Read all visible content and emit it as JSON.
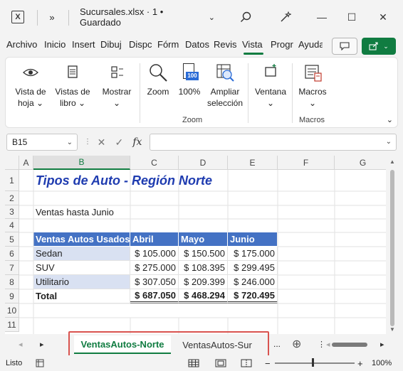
{
  "titlebar": {
    "app_letter": "X",
    "qat_more": "»",
    "doc_title": "Sucursales.xlsx  ·  1 • Guardado",
    "title_caret": "⌄",
    "minimize": "—",
    "maximize": "☐",
    "close": "✕"
  },
  "tabs": [
    {
      "label": "Archivo"
    },
    {
      "label": "Inicio"
    },
    {
      "label": "Insert"
    },
    {
      "label": "Dibuj"
    },
    {
      "label": "Dispc"
    },
    {
      "label": "Fórm"
    },
    {
      "label": "Datos"
    },
    {
      "label": "Revis"
    },
    {
      "label": "Vista"
    },
    {
      "label": "Progr"
    },
    {
      "label": "Ayuda"
    }
  ],
  "ribbon": {
    "vista_hoja": "Vista de\nhoja ⌄",
    "vistas_libro": "Vistas de\nlibro ⌄",
    "mostrar": "Mostrar\n⌄",
    "zoom": "Zoom",
    "zoom100": "100%",
    "zoom100_icon": "100",
    "ampliar": "Ampliar\nselección",
    "ventana": "Ventana\n⌄",
    "macros": "Macros\n⌄",
    "group_zoom": "Zoom",
    "group_macros": "Macros"
  },
  "formula_bar": {
    "name_box": "B15",
    "cancel": "✕",
    "confirm": "✓",
    "fx": "fx",
    "value": ""
  },
  "columns": [
    "A",
    "B",
    "C",
    "D",
    "E",
    "F",
    "G"
  ],
  "rows": [
    "1",
    "2",
    "3",
    "4",
    "5",
    "6",
    "7",
    "8",
    "9",
    "10",
    "11"
  ],
  "sheet": {
    "title": "Tipos de Auto - Región Norte",
    "subtitle": "Ventas hasta Junio",
    "table_headers": [
      "Ventas Autos Usados",
      "Abril",
      "Mayo",
      "Junio"
    ],
    "table_rows": [
      [
        "Sedan",
        "$ 105.000",
        "$ 150.500",
        "$ 175.000"
      ],
      [
        "SUV",
        "$ 275.000",
        "$ 108.395",
        "$ 299.495"
      ],
      [
        "Utilitario",
        "$ 307.050",
        "$ 209.399",
        "$ 246.000"
      ],
      [
        "Total",
        "$ 687.050",
        "$ 468.294",
        "$ 720.495"
      ]
    ]
  },
  "sheet_tabs": {
    "prev": "◂",
    "next": "▸",
    "tabs": [
      "VentasAutos-Norte",
      "VentasAutos-Sur"
    ],
    "more": "...",
    "add": "⊕"
  },
  "status": {
    "ready": "Listo",
    "zoom": "100%",
    "minus": "−",
    "plus": "+"
  },
  "colors": {
    "accent": "#107c41",
    "table_header": "#4472c4",
    "band": "#d9e1f2",
    "title_text": "#1f3cb0",
    "highlight": "#d9534f"
  }
}
